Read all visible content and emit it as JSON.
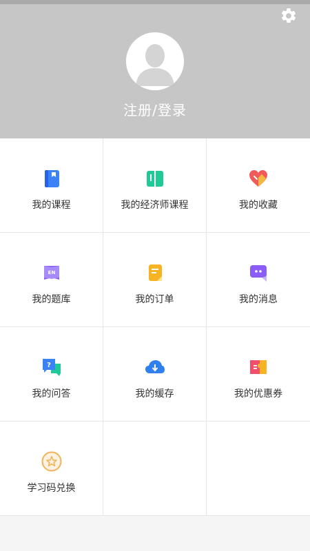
{
  "header": {
    "login_label": "注册/登录",
    "settings_icon": "gear-icon",
    "avatar_icon": "user-avatar-icon"
  },
  "menu": {
    "items": [
      {
        "label": "我的课程",
        "icon": "book-icon",
        "color": "#3b82f6"
      },
      {
        "label": "我的经济师课程",
        "icon": "open-book-icon",
        "color": "#20c997"
      },
      {
        "label": "我的收藏",
        "icon": "heart-icon",
        "color": "#f05a5a"
      },
      {
        "label": "我的题库",
        "icon": "question-bank-icon",
        "color": "#8b5cf6"
      },
      {
        "label": "我的订单",
        "icon": "order-icon",
        "color": "#f6b324"
      },
      {
        "label": "我的消息",
        "icon": "message-icon",
        "color": "#8b5cf6"
      },
      {
        "label": "我的问答",
        "icon": "qa-icon",
        "color": "#3b82f6"
      },
      {
        "label": "我的缓存",
        "icon": "cloud-download-icon",
        "color": "#2f80ed"
      },
      {
        "label": "我的优惠券",
        "icon": "coupon-icon",
        "color": "#f04e6a"
      },
      {
        "label": "学习码兑换",
        "icon": "star-badge-icon",
        "color": "#f0b35a"
      }
    ]
  }
}
